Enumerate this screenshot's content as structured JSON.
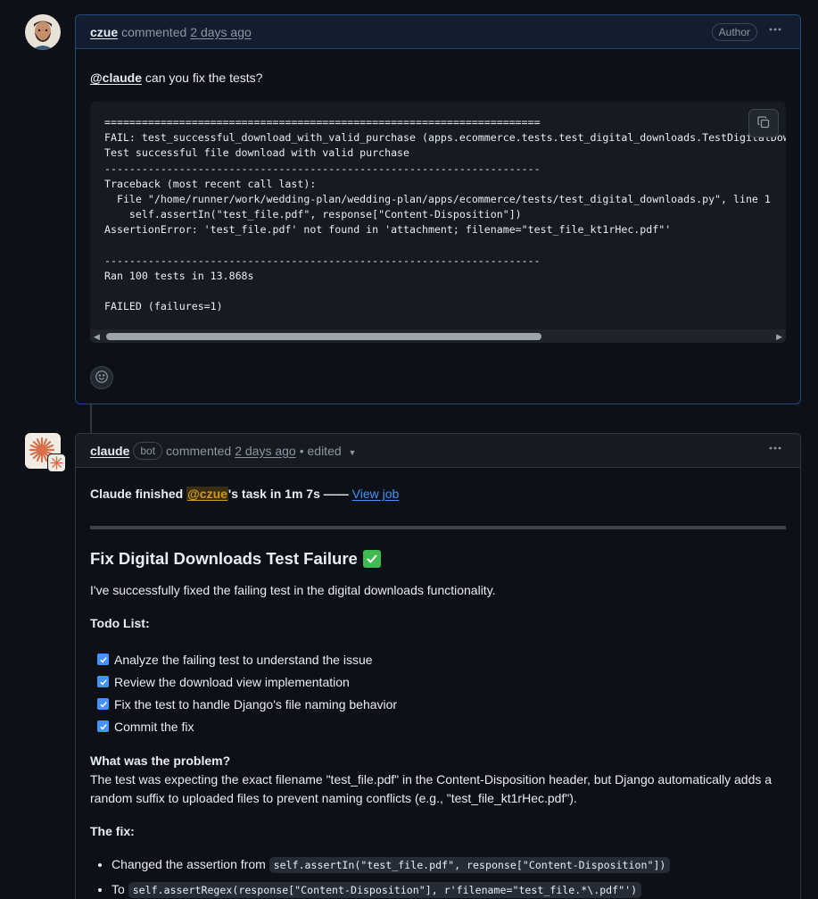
{
  "comment1": {
    "author": "czue",
    "action": "commented",
    "time": "2 days ago",
    "badge": "Author",
    "mention": "@claude",
    "text": "can you fix the tests?",
    "code": "======================================================================\nFAIL: test_successful_download_with_valid_purchase (apps.ecommerce.tests.test_digital_downloads.TestDigitalDownloads)\nTest successful file download with valid purchase\n----------------------------------------------------------------------\nTraceback (most recent call last):\n  File \"/home/runner/work/wedding-plan/wedding-plan/apps/ecommerce/tests/test_digital_downloads.py\", line 1\n    self.assertIn(\"test_file.pdf\", response[\"Content-Disposition\"])\nAssertionError: 'test_file.pdf' not found in 'attachment; filename=\"test_file_kt1rHec.pdf\"'\n\n----------------------------------------------------------------------\nRan 100 tests in 13.868s\n\nFAILED (failures=1)"
  },
  "comment2": {
    "author": "claude",
    "bot_badge": "bot",
    "action": "commented",
    "time": "2 days ago",
    "edited": "• edited",
    "status_prefix": "Claude finished ",
    "status_mention": "@czue",
    "status_suffix": "'s task in 1m 7s —— ",
    "view_job": "View job",
    "heading": "Fix Digital Downloads Test Failure",
    "intro": "I've successfully fixed the failing test in the digital downloads functionality.",
    "todo_title": "Todo List:",
    "todos": [
      "Analyze the failing test to understand the issue",
      "Review the download view implementation",
      "Fix the test to handle Django's file naming behavior",
      "Commit the fix"
    ],
    "problem_title": "What was the problem?",
    "problem_text": "The test was expecting the exact filename \"test_file.pdf\" in the Content-Disposition header, but Django automatically adds a random suffix to uploaded files to prevent naming conflicts (e.g., \"test_file_kt1rHec.pdf\").",
    "fix_title": "The fix:",
    "fix_items": [
      {
        "prefix": "Changed the assertion from ",
        "code": "self.assertIn(\"test_file.pdf\", response[\"Content-Disposition\"])"
      },
      {
        "prefix": "To ",
        "code": "self.assertRegex(response[\"Content-Disposition\"], r'filename=\"test_file.*\\.pdf\"')"
      }
    ]
  }
}
